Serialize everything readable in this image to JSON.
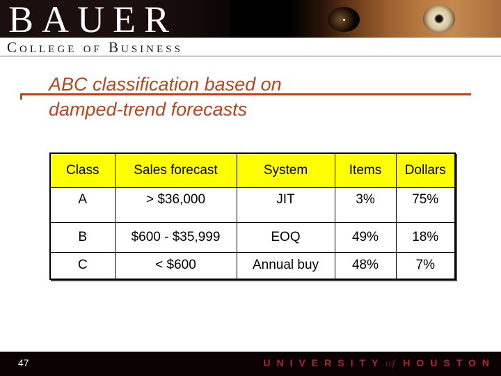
{
  "header": {
    "logo_text": "BAUER",
    "subtitle": "College of Business"
  },
  "slide": {
    "title_line1": "ABC classification based on",
    "title_line2": "damped-trend forecasts",
    "accent_color": "#b5461e"
  },
  "table": {
    "header_color": "#ffff00",
    "columns": [
      "Class",
      "Sales forecast",
      "System",
      "Items",
      "Dollars"
    ],
    "rows": [
      [
        "A",
        "> $36,000",
        "JIT",
        "3%",
        "75%"
      ],
      [
        "B",
        "$600 - $35,999",
        "EOQ",
        "49%",
        "18%"
      ],
      [
        "C",
        "< $600",
        "Annual buy",
        "48%",
        "7%"
      ]
    ]
  },
  "footer": {
    "page_number": "47",
    "wordmark_part1": "UNIVERSITY",
    "wordmark_of": "of",
    "wordmark_part2": "HOUSTON"
  }
}
